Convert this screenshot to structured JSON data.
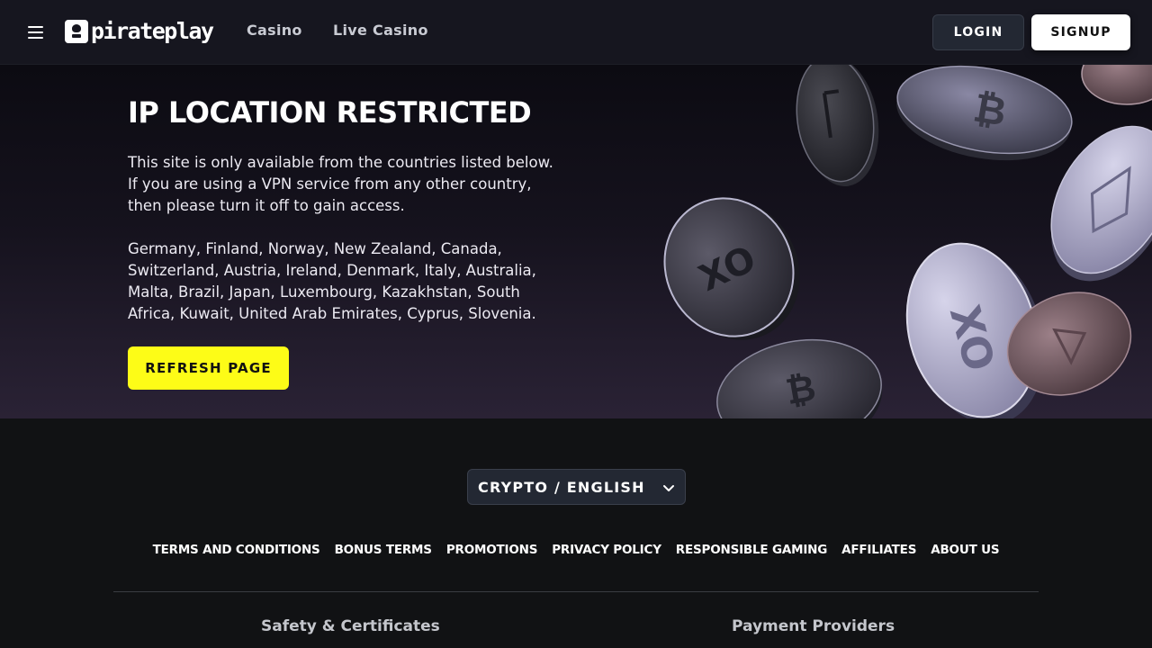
{
  "header": {
    "logo_text": "pirateplay",
    "nav": [
      {
        "label": "Casino"
      },
      {
        "label": "Live Casino"
      }
    ],
    "login_label": "LOGIN",
    "signup_label": "SIGNUP"
  },
  "hero": {
    "title": "IP LOCATION RESTRICTED",
    "description": "This site is only available from the countries listed below. If you are using a VPN service from any other country, then please turn it off to gain access.",
    "countries": "Germany, Finland, Norway, New Zealand, Canada, Switzerland, Austria, Ireland, Denmark, Italy, Australia, Malta, Brazil, Japan, Luxembourg, Kazakhstan, South Africa, Kuwait, United Arab Emirates, Cyprus, Slovenia.",
    "refresh_label": "REFRESH PAGE"
  },
  "footer": {
    "language_select": "CRYPTO / ENGLISH",
    "links": [
      {
        "label": "TERMS AND CONDITIONS"
      },
      {
        "label": "BONUS TERMS"
      },
      {
        "label": "PROMOTIONS"
      },
      {
        "label": "PRIVACY POLICY"
      },
      {
        "label": "RESPONSIBLE GAMING"
      },
      {
        "label": "AFFILIATES"
      },
      {
        "label": "ABOUT US"
      }
    ],
    "safety_heading": "Safety & Certificates",
    "payment_heading": "Payment Providers"
  },
  "colors": {
    "accent_yellow": "#fdfc17",
    "header_bg": "#16161f",
    "footer_bg": "#111214"
  },
  "icons": {
    "menu": "hamburger-menu-icon",
    "logo": "skull-logo-icon",
    "dropdown": "chevron-down-icon",
    "hero_art": "floating-crypto-coins"
  }
}
